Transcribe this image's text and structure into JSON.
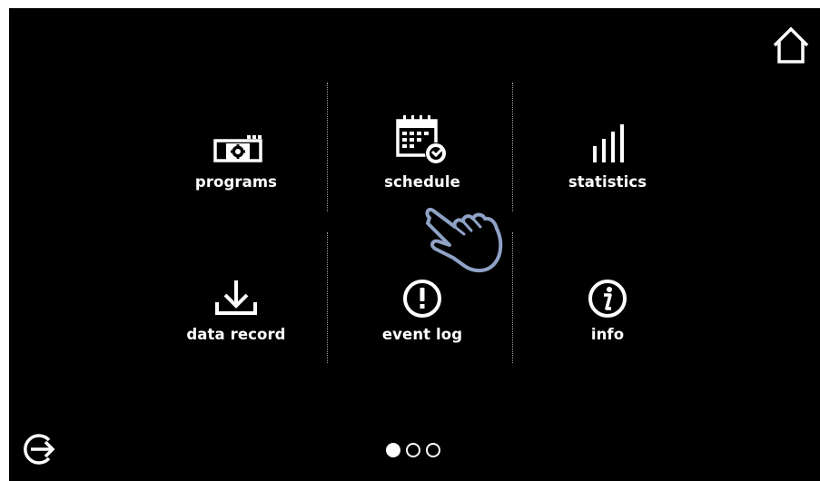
{
  "menu": {
    "items": [
      {
        "label": "programs",
        "icon": "programs-icon"
      },
      {
        "label": "schedule",
        "icon": "schedule-icon"
      },
      {
        "label": "statistics",
        "icon": "statistics-icon"
      },
      {
        "label": "data record",
        "icon": "download-icon"
      },
      {
        "label": "event log",
        "icon": "alert-icon"
      },
      {
        "label": "info",
        "icon": "info-icon"
      }
    ]
  },
  "pagination": {
    "pages": 3,
    "current": 1
  },
  "colors": {
    "background": "#000000",
    "foreground": "#ffffff",
    "divider": "#9a9a9a"
  }
}
